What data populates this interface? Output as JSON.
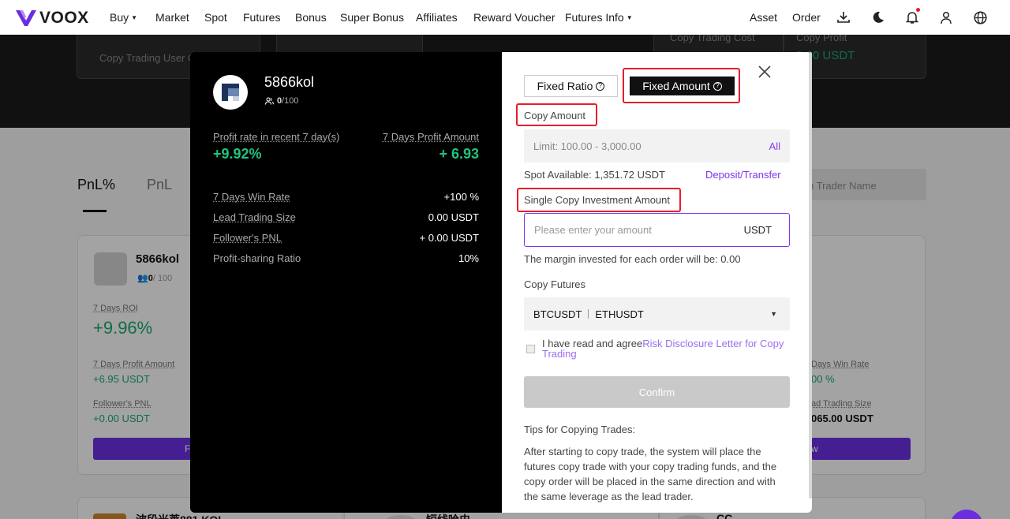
{
  "brand": {
    "name": "VOOX",
    "accent": "#7a35ee",
    "buy_color": "#20c37f"
  },
  "nav": {
    "items": [
      "Buy",
      "Market",
      "Spot",
      "Futures",
      "Bonus",
      "Super Bonus",
      "Affiliates",
      "Reward Voucher",
      "Futures Info"
    ],
    "right": [
      "Asset",
      "Order"
    ],
    "icons": [
      "download-icon",
      "moon-icon",
      "bell-icon",
      "user-icon",
      "globe-icon"
    ]
  },
  "background": {
    "hero_cards": [
      "Copy Trading User C",
      "Copy Trading Cost",
      "Copy Profit",
      "0.00 USDT"
    ],
    "tabs": [
      "PnL%",
      "PnL"
    ],
    "search_placeholder": "n Trader Name",
    "card1": {
      "name": "5866kol",
      "followers": "0",
      "followers_max": "/ 100",
      "roi_label": "7 Days ROI",
      "roi_value": "+9.96%",
      "profit_label": "7 Days Profit Amount",
      "profit_value": "+6.95 USDT",
      "follower_pnl_label": "Follower's PNL",
      "follower_pnl_value": "+0.00 USDT",
      "button": "F"
    },
    "card2": {
      "win_rate_label": "Days Win Rate",
      "win_rate_value": "00 %",
      "lead_size_label": "ad Trading Size",
      "lead_size_value": "065.00 USDT",
      "button": "w"
    },
    "bottom_cards": [
      "波段米莱881 KOL",
      "短线哈史",
      "CC"
    ]
  },
  "modal": {
    "trader": {
      "name": "5866kol",
      "followers": "0",
      "followers_max": "/100",
      "profit_rate_label": "Profit rate in recent 7 day(s)",
      "profit_rate_value": "+9.92%",
      "profit_amount_label": "7 Days Profit Amount",
      "profit_amount_value": "+ 6.93",
      "stats": [
        {
          "label": "7 Days Win Rate",
          "value": "+100 %"
        },
        {
          "label": "Lead Trading Size",
          "value": "0.00 USDT"
        },
        {
          "label": "Follower's PNL",
          "value": "+ 0.00 USDT"
        },
        {
          "label": "Profit-sharing Ratio",
          "value": "10%"
        }
      ]
    },
    "form": {
      "mode_ratio": "Fixed Ratio",
      "mode_amount": "Fixed Amount",
      "copy_amount_label": "Copy Amount",
      "limit_text": "Limit:  100.00 - 3,000.00",
      "all_label": "All",
      "spot_available": "Spot Available: 1,351.72 USDT",
      "deposit_link": "Deposit/Transfer",
      "single_label": "Single Copy Investment Amount",
      "amount_placeholder": "Please enter your amount",
      "amount_unit": "USDT",
      "margin_text": "The margin invested for each order will be: 0.00",
      "copy_futures_label": "Copy Futures",
      "futures": [
        "BTCUSDT",
        "ETHUSDT"
      ],
      "agree_text": "I have read and agree",
      "agree_link": "Risk Disclosure Letter for Copy Trading",
      "confirm": "Confirm",
      "tips_title": "Tips for Copying Trades:",
      "tips_body": "After starting to copy trade, the system will place the futures copy trade with your copy trading funds, and the copy order will be placed in the same direction and with the same leverage as the lead trader."
    }
  }
}
